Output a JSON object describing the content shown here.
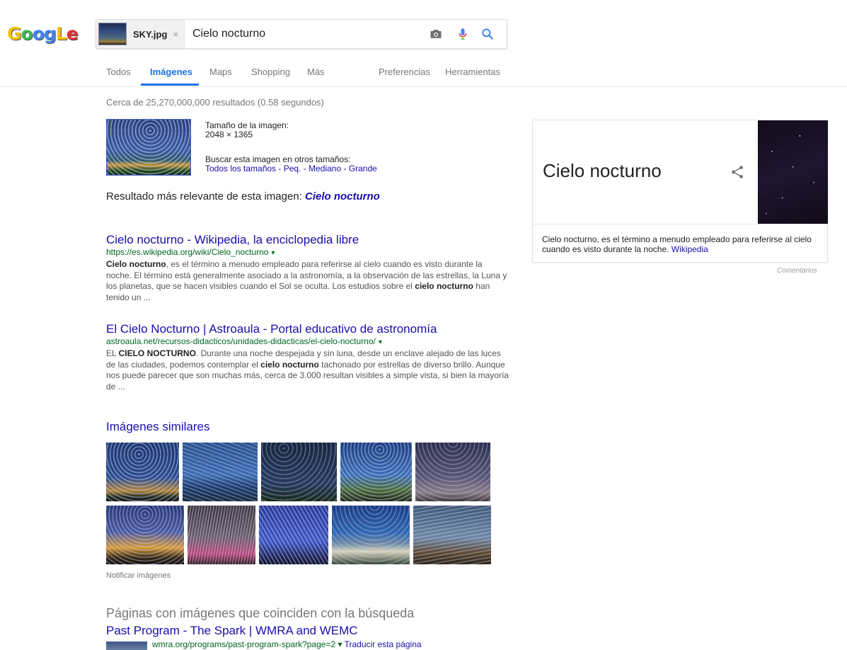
{
  "logo": {
    "letters": [
      {
        "ch": "G",
        "color": "#f4c20d"
      },
      {
        "ch": "o",
        "color": "#3cba54"
      },
      {
        "ch": "o",
        "color": "#4285f4"
      },
      {
        "ch": "g",
        "color": "#4285f4"
      },
      {
        "ch": "L",
        "color": "#f4c20d"
      },
      {
        "ch": "e",
        "color": "#db3236"
      }
    ]
  },
  "search": {
    "image_chip_name": "SKY.jpg",
    "image_chip_close": "×",
    "query": "Cielo nocturno"
  },
  "tabs": {
    "todos": "Todos",
    "imagenes": "Imágenes",
    "maps": "Maps",
    "shopping": "Shopping",
    "mas": "Más",
    "preferencias": "Preferencias",
    "herramientas": "Herramientas"
  },
  "result_stats": "Cerca de 25,270,000,000 resultados (0.58 segundos)",
  "image_info": {
    "size_label": "Tamaño de la imagen:",
    "size_value": "2048 × 1365",
    "other_sizes_label": "Buscar esta imagen en otros tamaños:",
    "all_sizes": "Todos los tamaños",
    "small": "Peq.",
    "medium": "Mediano",
    "large": "Grande",
    "separator": " - "
  },
  "best_guess": {
    "prefix": "Resultado más relevante de esta imagen: ",
    "link": "Cielo nocturno"
  },
  "results": [
    {
      "title": "Cielo nocturno - Wikipedia, la enciclopedia libre",
      "url": "https://es.wikipedia.org/wiki/Cielo_nocturno",
      "snippet_bold_1": "Cielo nocturno",
      "snippet_1": ", es el término a menudo empleado para referirse al cielo cuando es visto durante la noche. El término está generalmente asociado a la astronomía, a la observación de las estrellas, la Luna y los planetas, que se hacen visibles cuando el Sol se oculta. Los estudios sobre el ",
      "snippet_bold_2": "cielo nocturno",
      "snippet_2": " han tenido un ..."
    },
    {
      "title": "El Cielo Nocturno | Astroaula - Portal educativo de astronomía",
      "url": "astroaula.net/recursos-didacticos/unidades-didacticas/el-cielo-nocturno/",
      "snippet_1": "EL ",
      "snippet_bold_1": "CIELO NOCTURNO",
      "snippet_2": ". Durante una noche despejada y sin luna, desde un enclave alejado de las luces de las ciudades, podemos contemplar el ",
      "snippet_bold_2": "cielo nocturno",
      "snippet_3": " tachonado por estrellas de diverso brillo. Aunque nos puede parecer que son muchas más, cerca de 3.000 resultan visibles a simple vista, si bien la mayoría de ..."
    }
  ],
  "caret": "▾",
  "similar": {
    "heading": "Imágenes similares",
    "report": "Notificar imágenes"
  },
  "matching": {
    "heading": "Páginas con imágenes que coinciden con la búsqueda",
    "item_title": "Past Program - The Spark | WMRA and WEMC",
    "item_url": "wmra.org/programs/past-program-spark?page=2",
    "translate": "Traducir esta página"
  },
  "knowledge_panel": {
    "title": "Cielo nocturno",
    "description": "Cielo nocturno, es el término a menudo empleado para referirse al cielo cuando es visto durante la noche. ",
    "source": "Wikipedia",
    "feedback": "Comentarios"
  },
  "colors": {
    "link": "#1a0dab",
    "url_green": "#006621",
    "accent_blue": "#1a73e8"
  },
  "icons": {
    "camera": "camera-icon",
    "mic": "microphone-icon",
    "search": "search-icon",
    "share": "share-icon"
  }
}
